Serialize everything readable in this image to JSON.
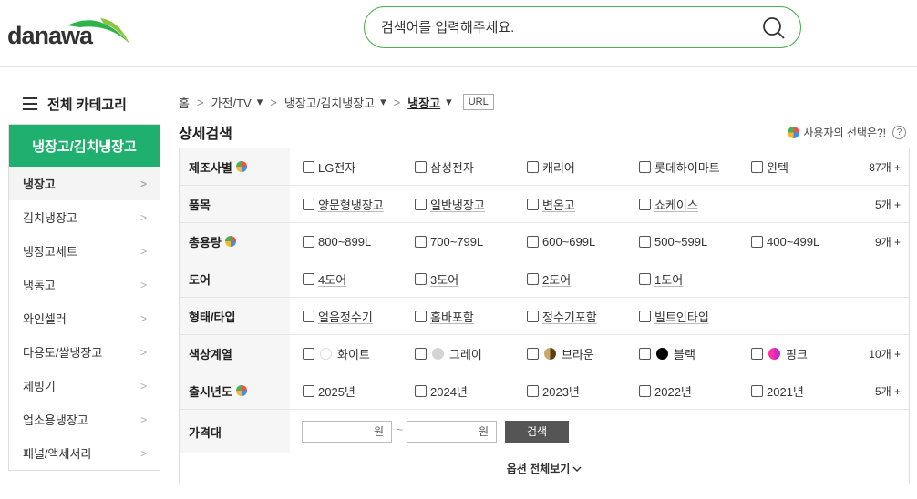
{
  "logo": {
    "text": "danawa"
  },
  "search": {
    "placeholder": "검색어를 입력해주세요."
  },
  "sidebar": {
    "header": "전체 카테고리",
    "active_category": "냉장고/김치냉장고",
    "items": [
      {
        "label": "냉장고"
      },
      {
        "label": "김치냉장고"
      },
      {
        "label": "냉장고세트"
      },
      {
        "label": "냉동고"
      },
      {
        "label": "와인셀러"
      },
      {
        "label": "다용도/쌀냉장고"
      },
      {
        "label": "제빙기"
      },
      {
        "label": "업소용냉장고"
      },
      {
        "label": "패널/액세서리"
      }
    ]
  },
  "breadcrumb": {
    "home": "홈",
    "c1": "가전/TV",
    "c2": "냉장고/김치냉장고",
    "c3": "냉장고",
    "url": "URL"
  },
  "detail": {
    "title": "상세검색",
    "user_choice": "사용자의 선택은?!",
    "help": "?"
  },
  "filters": {
    "maker": {
      "label": "제조사별",
      "options": [
        "LG전자",
        "삼성전자",
        "캐리어",
        "롯데하이마트",
        "윈텍"
      ],
      "count": "87개 +"
    },
    "type": {
      "label": "품목",
      "options": [
        "양문형냉장고",
        "일반냉장고",
        "변온고",
        "쇼케이스"
      ],
      "count": "5개 +"
    },
    "capacity": {
      "label": "총용량",
      "options": [
        "800~899L",
        "700~799L",
        "600~699L",
        "500~599L",
        "400~499L"
      ],
      "count": "9개 +"
    },
    "door": {
      "label": "도어",
      "options": [
        "4도어",
        "3도어",
        "2도어",
        "1도어"
      ]
    },
    "form": {
      "label": "형태/타입",
      "options": [
        "얼음정수기",
        "홈바포함",
        "정수기포함",
        "빌트인타입"
      ]
    },
    "color": {
      "label": "색상계열",
      "options": [
        {
          "name": "화이트",
          "swatch": "#ffffff"
        },
        {
          "name": "그레이",
          "swatch": "#d4d4d4"
        },
        {
          "name": "브라운",
          "swatch": "#7a5a2c"
        },
        {
          "name": "블랙",
          "swatch": "#000000"
        },
        {
          "name": "핑크",
          "swatch": "#ff3b8e"
        }
      ],
      "count": "10개 +"
    },
    "year": {
      "label": "출시년도",
      "options": [
        "2025년",
        "2024년",
        "2023년",
        "2022년",
        "2021년"
      ],
      "count": "5개 +"
    },
    "price": {
      "label": "가격대",
      "unit1": "원",
      "tilde": "~",
      "unit2": "원",
      "button": "검색"
    }
  },
  "more": {
    "label": "옵션 전체보기"
  },
  "colors": {
    "accent": "#1faf6e",
    "search_border": "#4caf50"
  }
}
